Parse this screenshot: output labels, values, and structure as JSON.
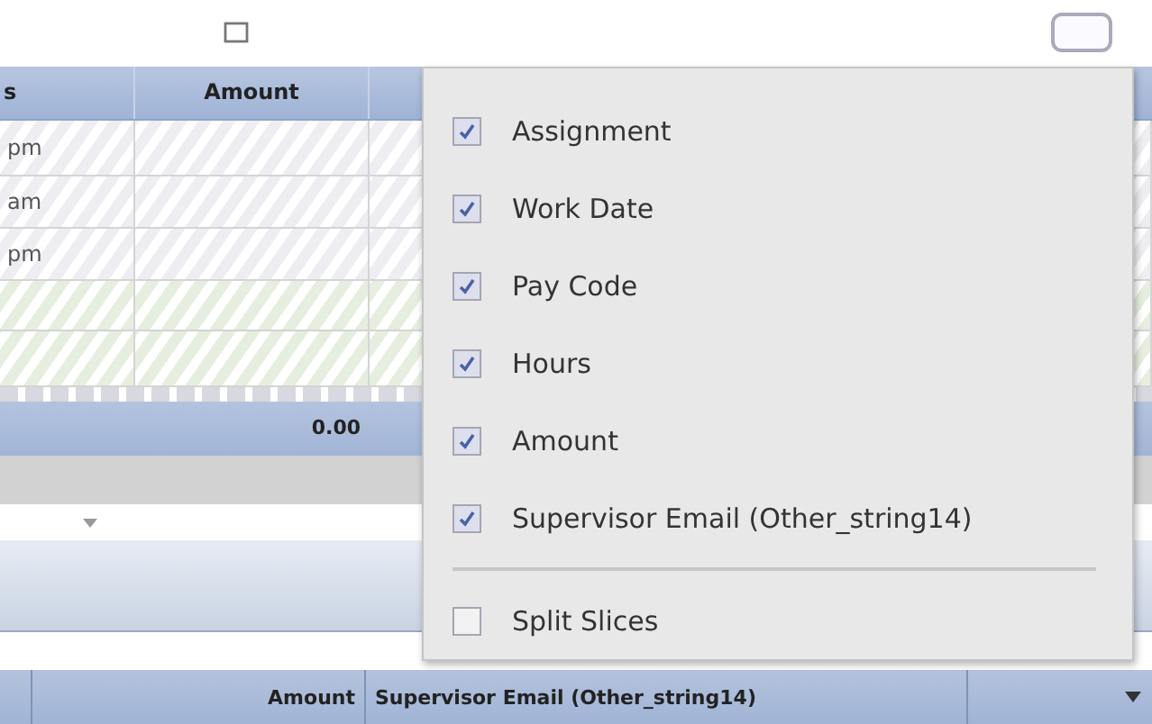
{
  "grid": {
    "columns": [
      "s",
      "Amount"
    ],
    "rows": [
      {
        "time": "pm",
        "green": false
      },
      {
        "time": "am",
        "green": false
      },
      {
        "time": "pm",
        "green": false
      },
      {
        "time": "",
        "green": true
      },
      {
        "time": "",
        "green": true
      }
    ],
    "total": "0.00"
  },
  "bottom_header": {
    "columns": [
      "Amount",
      "Supervisor Email (Other_string14)"
    ]
  },
  "column_menu": {
    "items": [
      {
        "label": "Assignment",
        "checked": true
      },
      {
        "label": "Work Date",
        "checked": true
      },
      {
        "label": "Pay Code",
        "checked": true
      },
      {
        "label": "Hours",
        "checked": true
      },
      {
        "label": "Amount",
        "checked": true
      },
      {
        "label": "Supervisor Email (Other_string14)",
        "checked": true
      }
    ],
    "options": [
      {
        "label": "Split Slices",
        "checked": false
      }
    ]
  }
}
